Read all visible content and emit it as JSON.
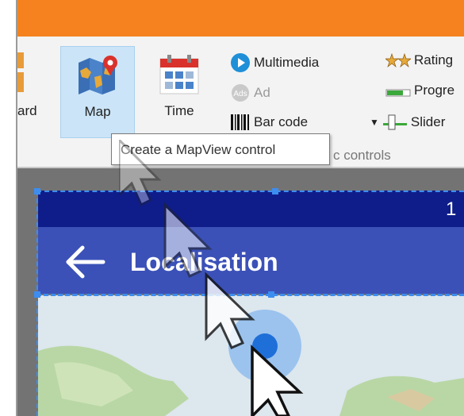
{
  "ribbon": {
    "partial_left_label": "ard",
    "map_button": {
      "label": "Map"
    },
    "time_button": {
      "label": "Time"
    },
    "items_col1": [
      {
        "label": "Multimedia",
        "icon": "play-circle-icon",
        "disabled": false
      },
      {
        "label": "Ad",
        "icon": "ad-badge-icon",
        "disabled": true
      },
      {
        "label": "Bar code",
        "icon": "barcode-icon",
        "disabled": false
      }
    ],
    "items_col2": [
      {
        "label": "Rating",
        "icon": "stars-icon"
      },
      {
        "label": "Progre",
        "icon": "progress-bar-icon"
      },
      {
        "label": "Slider",
        "icon": "slider-icon"
      }
    ],
    "group_label": "c controls"
  },
  "tooltip": {
    "text": "Create a MapView control"
  },
  "app_preview": {
    "status_time": "1",
    "title": "Localisation"
  },
  "colors": {
    "title_bar": "#f5821f",
    "status_bar": "#0f1d8a",
    "app_bar": "#3b51b8",
    "selection": "#3d8df0",
    "map_hover": "#cbe4f7"
  }
}
